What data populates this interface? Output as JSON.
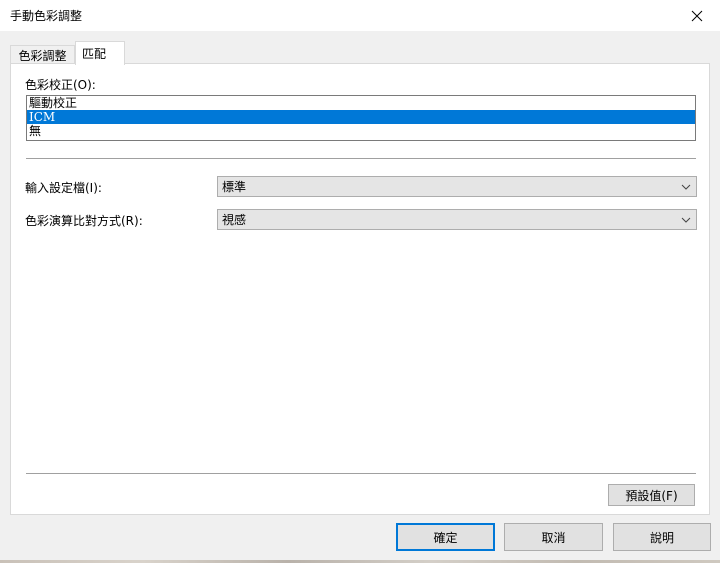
{
  "window": {
    "title": "手動色彩調整",
    "close_icon": "close-icon"
  },
  "tabs": [
    {
      "label": "色彩調整",
      "active": false
    },
    {
      "label": "匹配",
      "active": true
    }
  ],
  "color_correction": {
    "label": "色彩校正(O):",
    "options": [
      {
        "label": "驅動校正",
        "selected": false
      },
      {
        "label": "ICM",
        "selected": true
      },
      {
        "label": "無",
        "selected": false
      }
    ]
  },
  "input_profile": {
    "label": "輸入設定檔(I):",
    "value": "標準"
  },
  "rendering_intent": {
    "label": "色彩演算比對方式(R):",
    "value": "視感"
  },
  "buttons": {
    "defaults": "預設值(F)",
    "ok": "確定",
    "cancel": "取消",
    "help": "說明"
  },
  "colors": {
    "selection": "#0078d7",
    "dialog_bg": "#f0f0f0"
  }
}
